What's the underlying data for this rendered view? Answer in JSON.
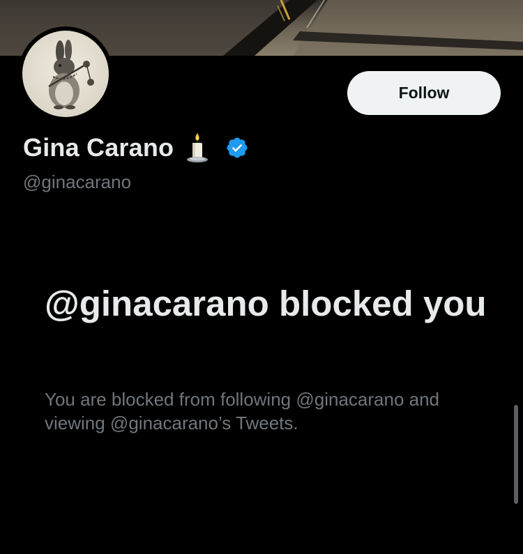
{
  "profile": {
    "display_name": "Gina Carano",
    "handle": "@ginacarano",
    "name_emoji_icon": "candle-icon",
    "verified_icon": "verified-badge-icon",
    "avatar_icon": "rabbit-illustration-avatar"
  },
  "actions": {
    "follow_label": "Follow"
  },
  "blocked_notice": {
    "title": "@ginacarano blocked you",
    "description": "You are blocked from following @ginacarano and viewing @ginacarano’s Tweets."
  },
  "colors": {
    "background": "#000000",
    "primary_text": "#e7e9ea",
    "secondary_text": "#71767b",
    "follow_button_bg": "#eff3f4",
    "verified_blue": "#1d9bf0"
  }
}
